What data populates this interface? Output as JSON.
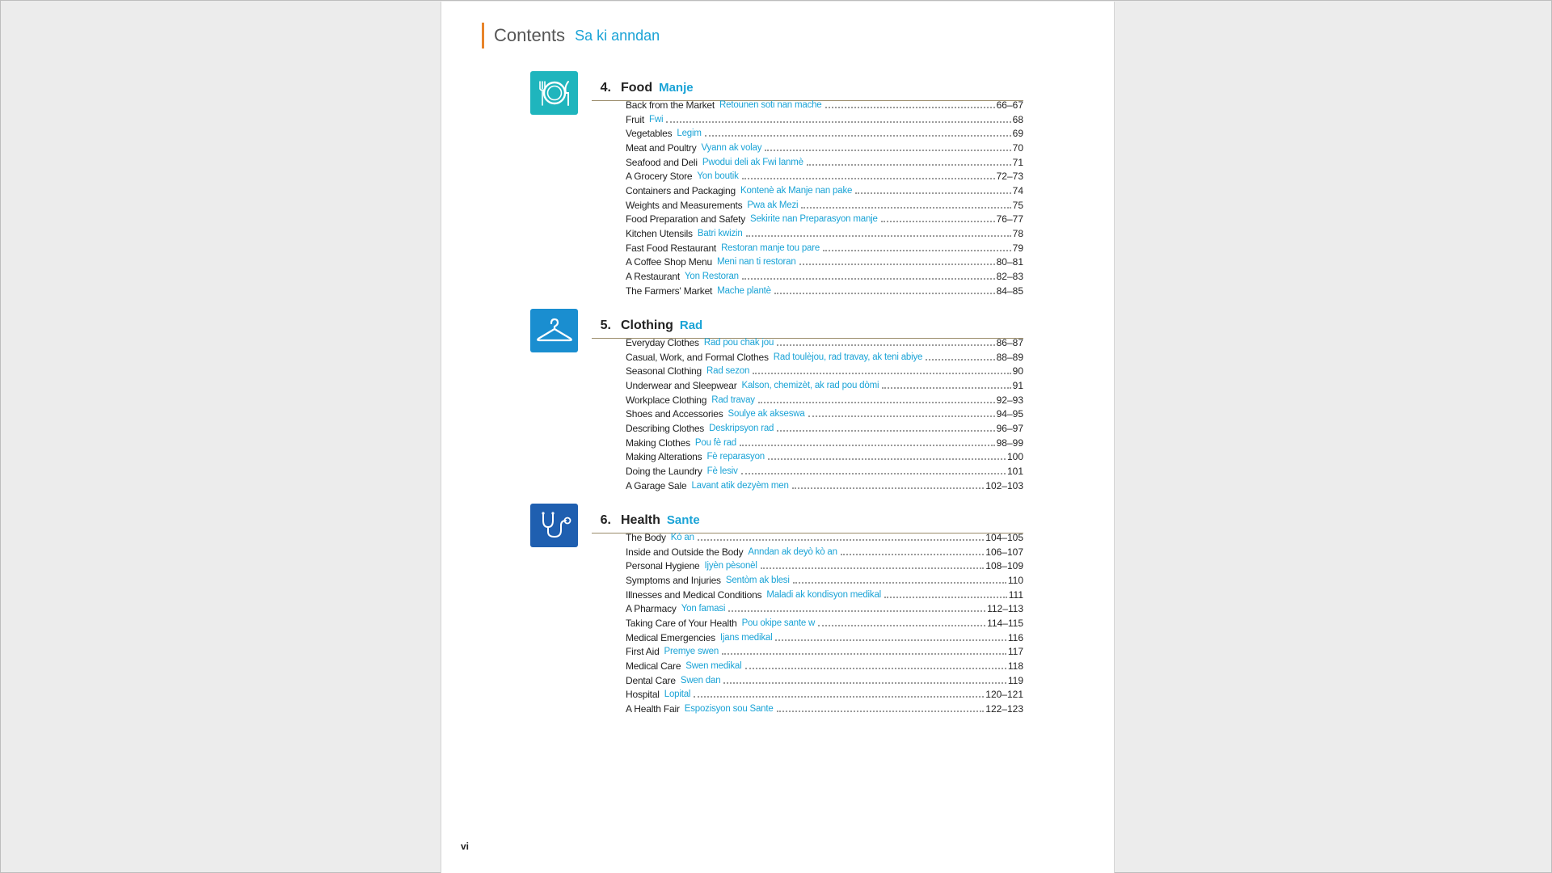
{
  "header": {
    "title_en": "Contents",
    "title_ht": "Sa ki anndan"
  },
  "sections": [
    {
      "number": "4.",
      "title_en": "Food",
      "title_ht": "Manje",
      "icon": "plate-fork-knife-icon",
      "icon_color": "#1fb5bd",
      "entries": [
        {
          "en": "Back from the Market",
          "ht": "Retounen soti nan mache",
          "page": "66–67"
        },
        {
          "en": "Fruit",
          "ht": "Fwi",
          "page": "68"
        },
        {
          "en": "Vegetables",
          "ht": "Legim",
          "page": "69"
        },
        {
          "en": "Meat and Poultry",
          "ht": "Vyann ak volay",
          "page": "70"
        },
        {
          "en": "Seafood and Deli",
          "ht": "Pwodui deli ak Fwi lanmè",
          "page": "71"
        },
        {
          "en": "A Grocery Store",
          "ht": "Yon boutik",
          "page": "72–73"
        },
        {
          "en": "Containers and Packaging",
          "ht": "Kontenè ak Manje nan pake",
          "page": "74"
        },
        {
          "en": "Weights and Measurements",
          "ht": "Pwa ak Mezi",
          "page": "75"
        },
        {
          "en": "Food Preparation and Safety",
          "ht": "Sekirite nan Preparasyon manje",
          "page": "76–77"
        },
        {
          "en": "Kitchen Utensils",
          "ht": "Batri kwizin",
          "page": "78"
        },
        {
          "en": "Fast Food Restaurant",
          "ht": "Restoran manje tou pare",
          "page": "79"
        },
        {
          "en": "A Coffee Shop Menu",
          "ht": "Meni nan ti restoran",
          "page": "80–81"
        },
        {
          "en": "A Restaurant",
          "ht": "Yon Restoran",
          "page": "82–83"
        },
        {
          "en": "The Farmers' Market",
          "ht": "Mache plantè",
          "page": "84–85"
        }
      ]
    },
    {
      "number": "5.",
      "title_en": "Clothing",
      "title_ht": "Rad",
      "icon": "hanger-icon",
      "icon_color": "#1a8ed0",
      "entries": [
        {
          "en": "Everyday Clothes",
          "ht": "Rad pou chak jou",
          "page": "86–87"
        },
        {
          "en": "Casual, Work, and Formal Clothes",
          "ht": "Rad toulèjou, rad travay, ak teni abiye",
          "page": "88–89"
        },
        {
          "en": "Seasonal Clothing",
          "ht": "Rad sezon",
          "page": "90"
        },
        {
          "en": "Underwear and Sleepwear",
          "ht": "Kalson, chemizèt, ak rad pou dòmi",
          "page": "91"
        },
        {
          "en": "Workplace Clothing",
          "ht": "Rad travay",
          "page": "92–93"
        },
        {
          "en": "Shoes and Accessories",
          "ht": "Soulye ak akseswa",
          "page": "94–95"
        },
        {
          "en": "Describing Clothes",
          "ht": "Deskripsyon rad",
          "page": "96–97"
        },
        {
          "en": "Making Clothes",
          "ht": "Pou fè rad",
          "page": "98–99"
        },
        {
          "en": "Making Alterations",
          "ht": "Fè reparasyon",
          "page": "100"
        },
        {
          "en": "Doing the Laundry",
          "ht": "Fè lesiv",
          "page": "101"
        },
        {
          "en": "A Garage Sale",
          "ht": "Lavant atik dezyèm men",
          "page": "102–103"
        }
      ]
    },
    {
      "number": "6.",
      "title_en": "Health",
      "title_ht": "Sante",
      "icon": "stethoscope-icon",
      "icon_color": "#1f5fb0",
      "entries": [
        {
          "en": "The Body",
          "ht": "Kò an",
          "page": "104–105"
        },
        {
          "en": "Inside and Outside the Body",
          "ht": "Anndan ak deyò kò an",
          "page": "106–107"
        },
        {
          "en": "Personal Hygiene",
          "ht": "Ijyèn pèsonèl",
          "page": "108–109"
        },
        {
          "en": "Symptoms and Injuries",
          "ht": "Sentòm ak blesi",
          "page": "110"
        },
        {
          "en": "Illnesses and Medical Conditions",
          "ht": "Maladi ak kondisyon medikal",
          "page": "111"
        },
        {
          "en": "A Pharmacy",
          "ht": "Yon famasi",
          "page": "112–113"
        },
        {
          "en": "Taking Care of Your Health",
          "ht": "Pou okipe sante w",
          "page": "114–115"
        },
        {
          "en": "Medical Emergencies",
          "ht": "Ijans medikal",
          "page": "116"
        },
        {
          "en": "First Aid",
          "ht": "Premye swen",
          "page": "117"
        },
        {
          "en": "Medical Care",
          "ht": "Swen medikal",
          "page": "118"
        },
        {
          "en": "Dental Care",
          "ht": "Swen dan",
          "page": "119"
        },
        {
          "en": "Hospital",
          "ht": "Lopital",
          "page": "120–121"
        },
        {
          "en": "A Health Fair",
          "ht": "Espozisyon sou Sante",
          "page": "122–123"
        }
      ]
    }
  ],
  "footer": {
    "page_number": "vi"
  }
}
